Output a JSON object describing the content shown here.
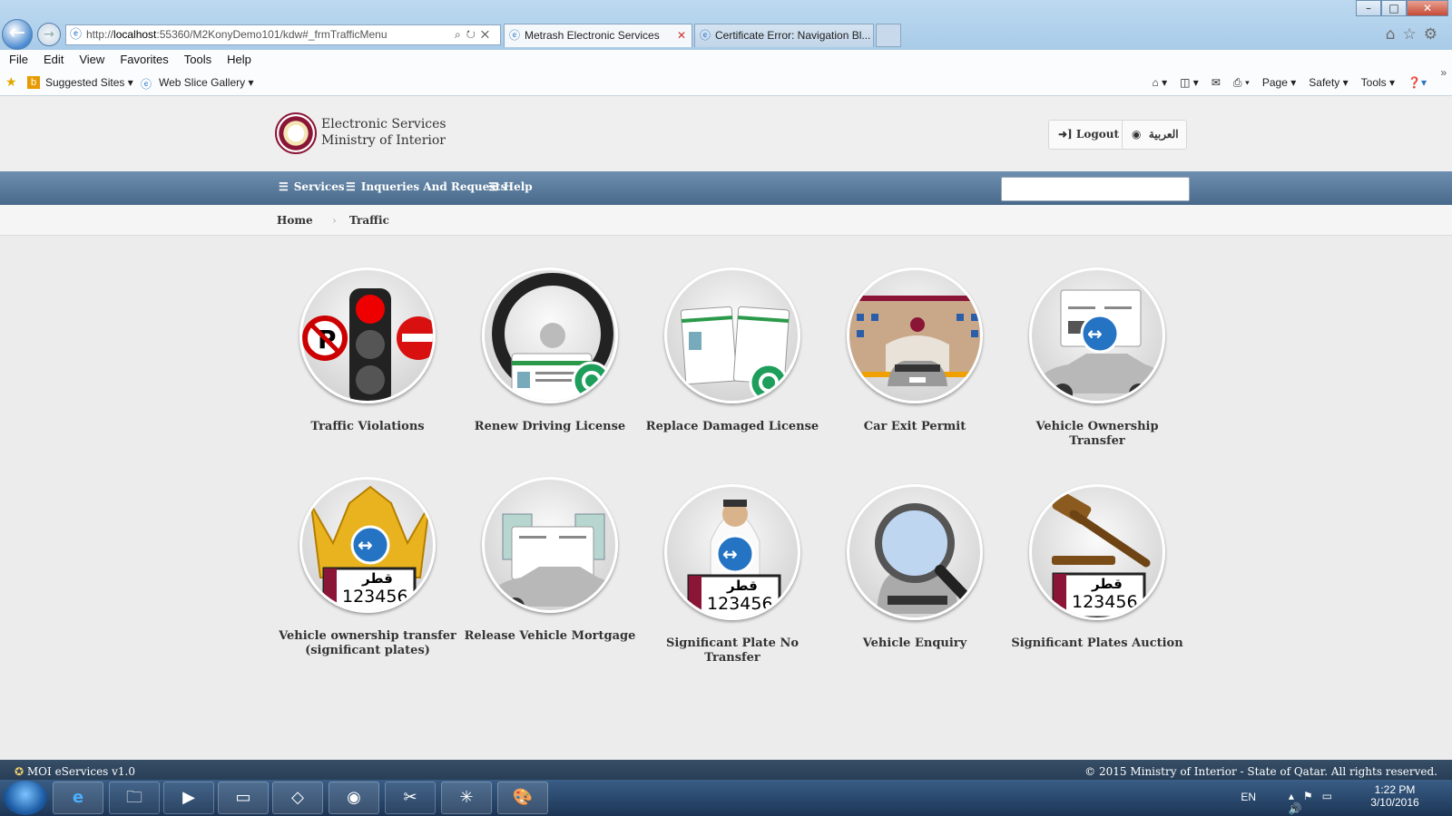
{
  "browser": {
    "url_prefix": "http://",
    "url_host": "localhost",
    "url_rest": ":55360/M2KonyDemo101/kdw#_frmTrafficMenu",
    "tabs": [
      {
        "label": "Metrash Electronic Services"
      },
      {
        "label": "Certificate Error: Navigation Bl..."
      }
    ],
    "menu": [
      "File",
      "Edit",
      "View",
      "Favorites",
      "Tools",
      "Help"
    ],
    "favorites": {
      "suggested_sites": "Suggested Sites",
      "web_slice": "Web Slice Gallery"
    },
    "commands": {
      "page": "Page",
      "safety": "Safety",
      "tools": "Tools"
    }
  },
  "site": {
    "title_line1": "Electronic Services",
    "title_line2": "Ministry of Interior",
    "logout": "Logout",
    "language": "العربية"
  },
  "nav": {
    "services": "Services",
    "inquiries": "Inqueries And Requests",
    "help": "Help",
    "search_placeholder": ""
  },
  "breadcrumb": {
    "home": "Home",
    "current": "Traffic"
  },
  "services": [
    {
      "label": "Traffic Violations",
      "icon": "traffic-light-icon"
    },
    {
      "label": "Renew Driving License",
      "icon": "steering-wheel-license-icon"
    },
    {
      "label": "Replace Damaged License",
      "icon": "license-cards-icon"
    },
    {
      "label": "Car Exit Permit",
      "icon": "border-gate-car-icon"
    },
    {
      "label": "Vehicle Ownership Transfer",
      "icon": "car-transfer-icon"
    },
    {
      "label": "Vehicle ownership transfer (significant plates)",
      "icon": "crown-plate-icon",
      "plate_ar": "قطر",
      "plate_no": "123456"
    },
    {
      "label": "Release Vehicle Mortgage",
      "icon": "car-money-icon"
    },
    {
      "label": "Significant Plate No Transfer",
      "icon": "person-plate-icon",
      "plate_ar": "قطر",
      "plate_no": "123456"
    },
    {
      "label": "Vehicle Enquiry",
      "icon": "magnifier-car-icon"
    },
    {
      "label": "Significant Plates Auction",
      "icon": "gavel-plate-icon",
      "plate_ar": "قطر",
      "plate_no": "123456"
    }
  ],
  "footer": {
    "left": "MOI eServices v1.0",
    "right": "© 2015 Ministry of Interior - State of Qatar. All rights reserved."
  },
  "taskbar": {
    "lang": "EN",
    "time": "1:22 PM",
    "date": "3/10/2016"
  },
  "colors": {
    "nav_blue": "#48698b",
    "maroon": "#8b1537",
    "footer": "#243a52"
  }
}
